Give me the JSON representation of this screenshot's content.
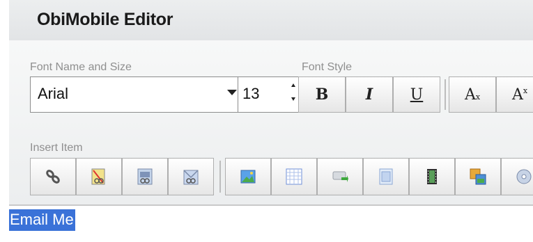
{
  "app": {
    "title": "ObiMobile Editor"
  },
  "toolbar": {
    "font_group_label": "Font Name and Size",
    "font_name": "Arial",
    "font_size": "13",
    "style_group_label": "Font Style",
    "style_buttons": {
      "bold": "B",
      "italic": "I",
      "underline": "U",
      "subscript_main": "A",
      "subscript_sub": "x",
      "superscript_main": "A",
      "superscript_sup": "x"
    },
    "insert_group_label": "Insert Item",
    "insert_icons": [
      "link-icon",
      "broken-link-icon",
      "phone-link-icon",
      "email-link-icon",
      "image-icon",
      "table-icon",
      "button-icon",
      "form-icon",
      "video-icon",
      "gallery-icon",
      "media-icon"
    ]
  },
  "content": {
    "selected_text": "Email Me"
  },
  "colors": {
    "selection": "#3a72d8",
    "chrome": "#eceeef"
  }
}
